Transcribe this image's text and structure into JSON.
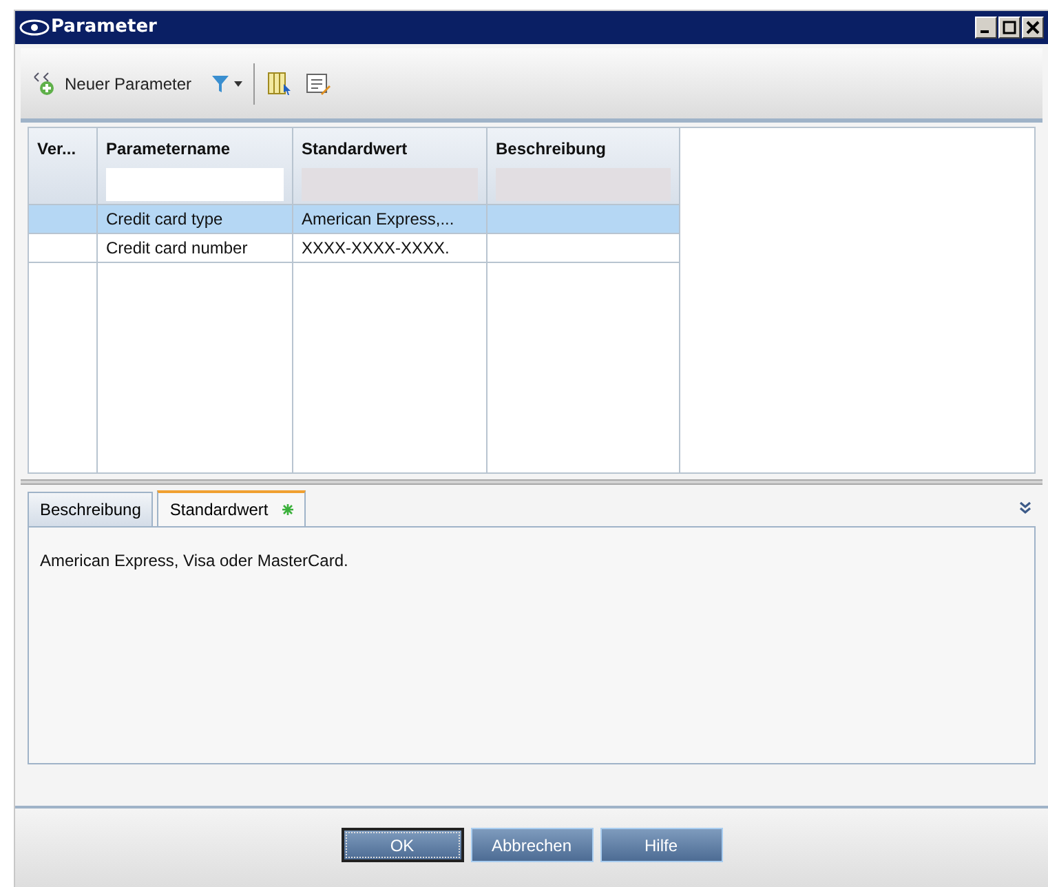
{
  "window": {
    "title": "Parameter"
  },
  "toolbar": {
    "new_button": "Neuer Parameter"
  },
  "table": {
    "columns": [
      {
        "label": "Ver...",
        "has_filter": false
      },
      {
        "label": "Parametername",
        "has_filter": true,
        "filter_disabled": false
      },
      {
        "label": "Standardwert",
        "has_filter": true,
        "filter_disabled": true
      },
      {
        "label": "Beschreibung",
        "has_filter": true,
        "filter_disabled": true
      }
    ],
    "rows": [
      {
        "selected": true,
        "cells": [
          "",
          "Credit card type",
          "American Express,...",
          ""
        ]
      },
      {
        "selected": false,
        "cells": [
          "",
          "Credit card number",
          "XXXX-XXXX-XXXX.",
          ""
        ]
      }
    ]
  },
  "tabs": [
    {
      "label": "Beschreibung",
      "selected": false,
      "modified": false
    },
    {
      "label": "Standardwert",
      "selected": true,
      "modified": true
    }
  ],
  "tab_content": "American Express, Visa oder MasterCard.",
  "buttons": [
    {
      "label": "OK",
      "focused": true
    },
    {
      "label": "Abbrechen",
      "focused": false
    },
    {
      "label": "Hilfe",
      "focused": false
    }
  ]
}
